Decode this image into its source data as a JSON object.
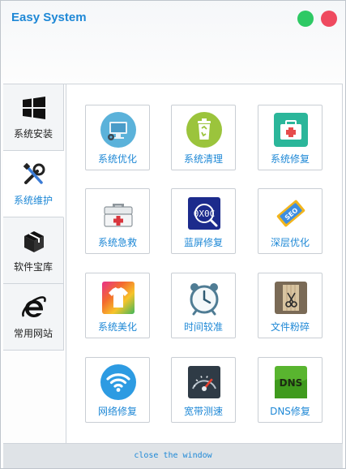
{
  "app": {
    "title": "Easy System"
  },
  "window_controls": {
    "minimize_icon": "green-circle",
    "close_icon": "red-circle"
  },
  "sidebar": {
    "items": [
      {
        "label": "系统安装",
        "icon": "windows-logo-icon",
        "active": false
      },
      {
        "label": "系统维护",
        "icon": "wrench-screwdriver-icon",
        "active": true
      },
      {
        "label": "软件宝库",
        "icon": "box-icon",
        "active": false
      },
      {
        "label": "常用网站",
        "icon": "ie-browser-icon",
        "active": false
      }
    ]
  },
  "tiles": [
    {
      "label": "系统优化",
      "icon": "monitor-gear-icon"
    },
    {
      "label": "系统清理",
      "icon": "recycle-bin-icon"
    },
    {
      "label": "系统修复",
      "icon": "first-aid-kit-icon"
    },
    {
      "label": "系统急救",
      "icon": "toolbox-icon"
    },
    {
      "label": "蓝屏修复",
      "icon": "bsod-search-icon"
    },
    {
      "label": "深层优化",
      "icon": "seo-tag-icon"
    },
    {
      "label": "系统美化",
      "icon": "tshirt-icon"
    },
    {
      "label": "时间较准",
      "icon": "alarm-clock-icon"
    },
    {
      "label": "文件粉碎",
      "icon": "file-shredder-icon"
    },
    {
      "label": "网络修复",
      "icon": "wifi-icon"
    },
    {
      "label": "宽带测速",
      "icon": "speedometer-icon"
    },
    {
      "label": "DNS修复",
      "icon": "dns-icon"
    }
  ],
  "footer": {
    "link": "close the window"
  },
  "colors": {
    "accent": "#1e88d6",
    "minimize": "#2ec964",
    "close": "#ef4a5f"
  }
}
